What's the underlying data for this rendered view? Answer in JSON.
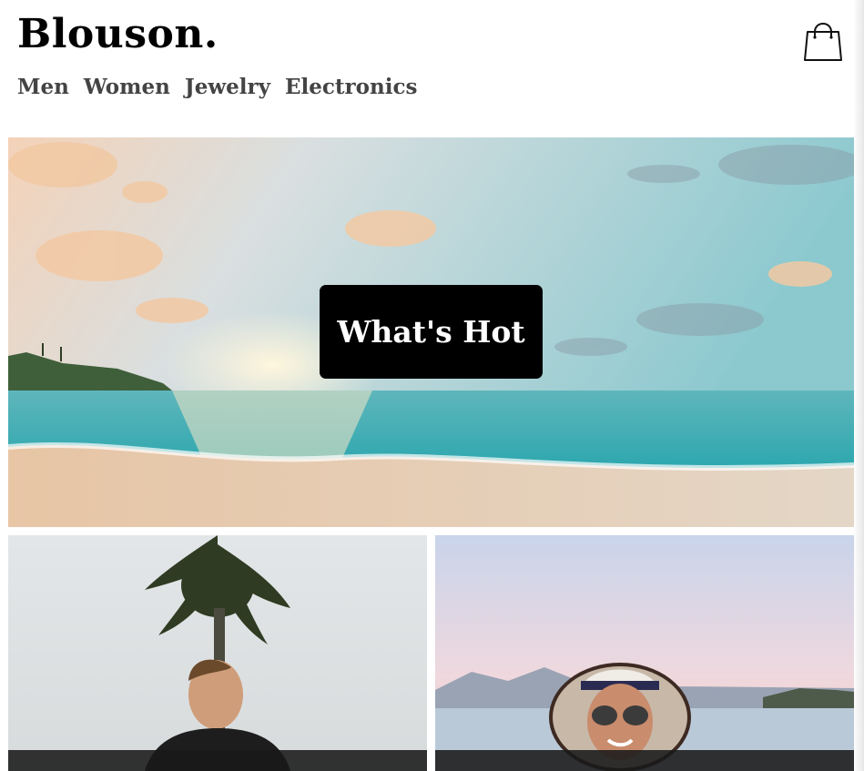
{
  "header": {
    "logo": "Blouson.",
    "cart_icon": "shopping-bag-icon"
  },
  "nav": {
    "items": [
      {
        "label": "Men"
      },
      {
        "label": "Women"
      },
      {
        "label": "Jewelry"
      },
      {
        "label": "Electronics"
      }
    ]
  },
  "hero": {
    "image": "beach-sunset-photo",
    "button_label": "What's Hot"
  },
  "tiles": [
    {
      "image": "man-palm-tree-photo"
    },
    {
      "image": "woman-sunhat-beach-photo"
    }
  ],
  "colors": {
    "text": "#000000",
    "nav_text": "#444444",
    "button_bg": "#000000",
    "button_text": "#ffffff"
  }
}
